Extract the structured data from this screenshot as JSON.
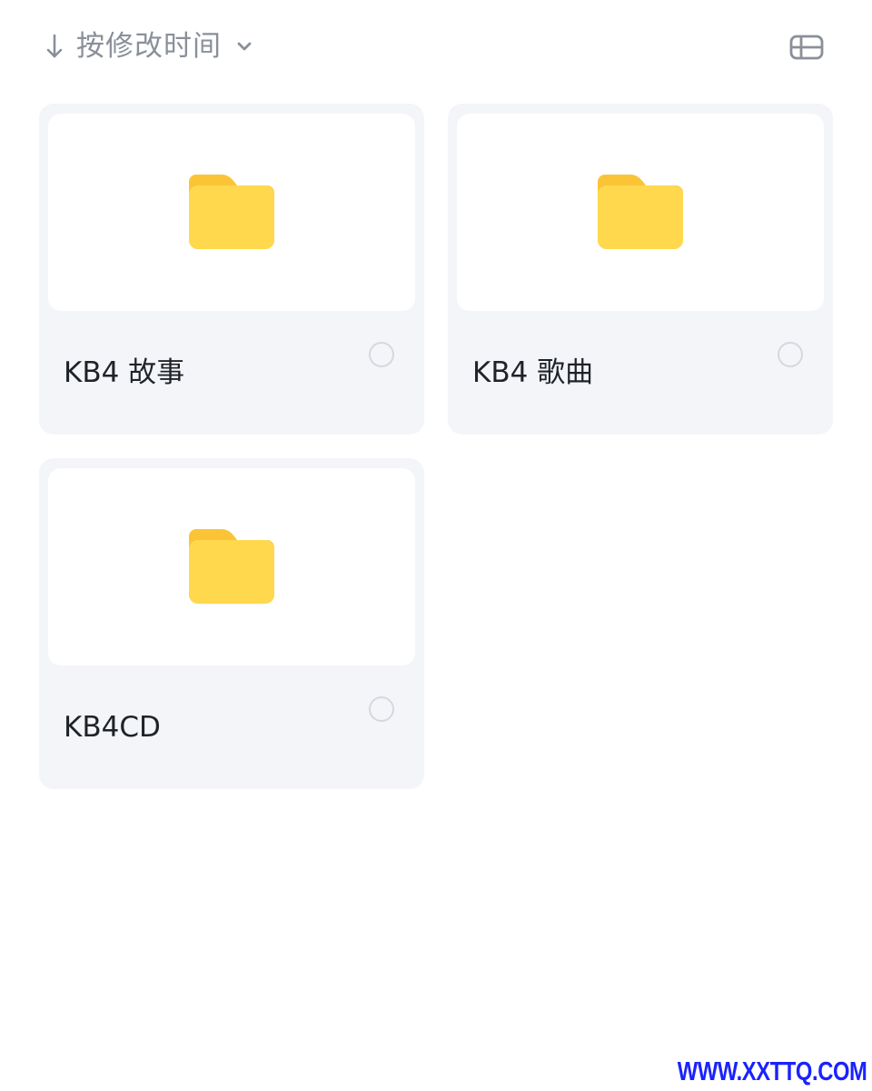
{
  "toolbar": {
    "sort_label": "按修改时间",
    "sort_icon": "arrow-down-icon",
    "dropdown_icon": "chevron-down-icon",
    "view_icon": "grid-view-toggle-icon"
  },
  "folders": [
    {
      "name": "KB4 故事",
      "icon": "folder-icon"
    },
    {
      "name": "KB4 歌曲",
      "icon": "folder-icon"
    },
    {
      "name": "KB4CD",
      "icon": "folder-icon"
    }
  ],
  "colors": {
    "folder_front": "#ffd84d",
    "folder_back": "#fbc437",
    "card_bg": "#f4f5f9",
    "muted_text": "#8a8f99",
    "watermark": "#1a22ff"
  },
  "watermark": "WWW.XXTTQ.COM"
}
